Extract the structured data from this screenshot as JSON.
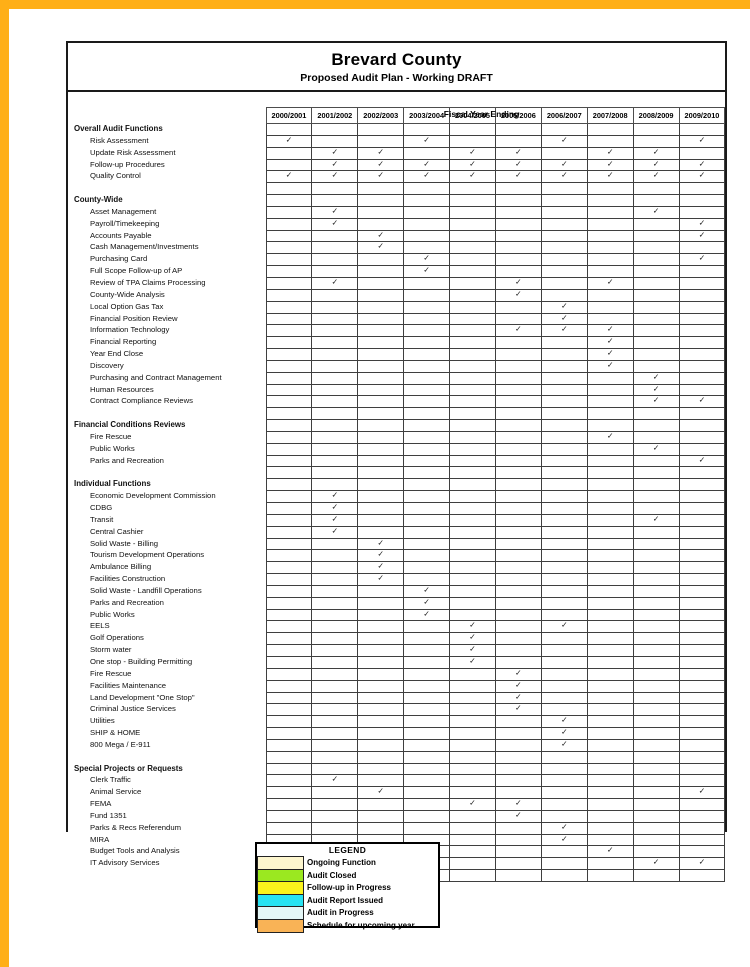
{
  "document": {
    "title_main": "Brevard County",
    "title_sub": "Proposed Audit Plan - Working DRAFT",
    "fiscal_year_header": "Fiscal Year Ending"
  },
  "columns": [
    "2000/2001",
    "2001/2002",
    "2002/2003",
    "2003/2004",
    "2004/2005",
    "2005/2006",
    "2006/2007",
    "2007/2008",
    "2008/2009",
    "2009/2010"
  ],
  "status_colors": {
    "ongoing": "#FDF6CE",
    "closed": "#9BE820",
    "followup": "#FAF31C",
    "issued": "#27E3F2",
    "inprogress": "#E4F7F7",
    "scheduled": "#F9B356"
  },
  "check_glyph": "✓",
  "legend": {
    "title": "LEGEND",
    "items": [
      {
        "label": "Ongoing Function",
        "key": "ongoing"
      },
      {
        "label": "Audit Closed",
        "key": "closed"
      },
      {
        "label": "Follow-up in Progress",
        "key": "followup"
      },
      {
        "label": "Audit Report Issued",
        "key": "issued"
      },
      {
        "label": "Audit in Progress",
        "key": "inprogress"
      },
      {
        "label": "Schedule for upcoming year",
        "key": "scheduled"
      }
    ]
  },
  "sections": [
    {
      "name": "Overall Audit Functions",
      "rows": [
        {
          "label": "Risk Assessment",
          "marks": {
            "0": "ongoing",
            "3": "ongoing",
            "6": "ongoing",
            "9": "ongoing"
          }
        },
        {
          "label": "Update Risk Assessment",
          "marks": {
            "1": "ongoing",
            "2": "ongoing",
            "4": "ongoing",
            "5": "ongoing",
            "7": "ongoing",
            "8": "ongoing"
          }
        },
        {
          "label": "Follow-up Procedures",
          "marks": {
            "1": "ongoing",
            "2": "ongoing",
            "3": "ongoing",
            "4": "ongoing",
            "5": "ongoing",
            "6": "ongoing",
            "7": "ongoing",
            "8": "ongoing",
            "9": "ongoing"
          }
        },
        {
          "label": "Quality Control",
          "marks": {
            "0": "ongoing",
            "1": "ongoing",
            "2": "ongoing",
            "3": "ongoing",
            "4": "ongoing",
            "5": "ongoing",
            "6": "ongoing",
            "7": "ongoing",
            "8": "ongoing",
            "9": "ongoing"
          }
        }
      ]
    },
    {
      "name": "County-Wide",
      "rows": [
        {
          "label": "Asset Management",
          "marks": {
            "1": "closed",
            "8": "issued"
          }
        },
        {
          "label": "Payroll/Timekeeping",
          "marks": {
            "1": "closed",
            "9": "scheduled"
          }
        },
        {
          "label": "Accounts Payable",
          "marks": {
            "2": "closed",
            "9": "scheduled"
          }
        },
        {
          "label": "Cash Management/Investments",
          "marks": {
            "2": "closed"
          }
        },
        {
          "label": "Purchasing Card",
          "marks": {
            "3": "closed",
            "9": "scheduled"
          }
        },
        {
          "label": "Full Scope Follow-up of AP",
          "marks": {
            "3": "closed"
          }
        },
        {
          "label": "Review of TPA Claims Processing",
          "marks": {
            "1": "closed",
            "5": "closed",
            "7": "closed"
          }
        },
        {
          "label": "County-Wide Analysis",
          "marks": {
            "5": "closed"
          }
        },
        {
          "label": "Local Option Gas Tax",
          "marks": {
            "6": "closed"
          }
        },
        {
          "label": "Financial Position Review",
          "marks": {
            "6": "closed"
          }
        },
        {
          "label": "Information Technology",
          "marks": {
            "5": "followup",
            "6": "followup",
            "7": "followup"
          }
        },
        {
          "label": "Financial Reporting",
          "marks": {
            "7": "issued"
          }
        },
        {
          "label": "Year End Close",
          "marks": {
            "7": "followup"
          }
        },
        {
          "label": "Discovery",
          "marks": {
            "7": "closed"
          }
        },
        {
          "label": "Purchasing and Contract Management",
          "marks": {
            "8": "issued"
          }
        },
        {
          "label": "Human Resources",
          "marks": {
            "8": "issued"
          }
        },
        {
          "label": "Contract Compliance Reviews",
          "marks": {
            "8": "issued",
            "9": "scheduled"
          }
        }
      ]
    },
    {
      "name": "Financial Conditions Reviews",
      "rows": [
        {
          "label": "Fire Rescue",
          "marks": {
            "7": "followup"
          }
        },
        {
          "label": "Public Works",
          "marks": {
            "8": "inprogress"
          }
        },
        {
          "label": "Parks and Recreation",
          "marks": {
            "9": "scheduled"
          }
        }
      ]
    },
    {
      "name": "Individual Functions",
      "rows": [
        {
          "label": "Economic Development Commission",
          "marks": {
            "1": "closed"
          }
        },
        {
          "label": "CDBG",
          "marks": {
            "1": "closed"
          }
        },
        {
          "label": "Transit",
          "marks": {
            "1": "closed",
            "8": "followup"
          }
        },
        {
          "label": "Central Cashier",
          "marks": {
            "1": "closed"
          }
        },
        {
          "label": "Solid Waste - Billing",
          "marks": {
            "2": "closed"
          }
        },
        {
          "label": "Tourism Development Operations",
          "marks": {
            "2": "closed"
          }
        },
        {
          "label": "Ambulance Billing",
          "marks": {
            "2": "closed"
          }
        },
        {
          "label": "Facilities Construction",
          "marks": {
            "2": "closed"
          }
        },
        {
          "label": "Solid Waste - Landfill Operations",
          "marks": {
            "3": "closed"
          }
        },
        {
          "label": "Parks and Recreation",
          "marks": {
            "3": "closed"
          }
        },
        {
          "label": "Public Works",
          "marks": {
            "3": "closed"
          }
        },
        {
          "label": "EELS",
          "marks": {
            "4": "closed",
            "6": "closed"
          }
        },
        {
          "label": "Golf Operations",
          "marks": {
            "4": "closed"
          }
        },
        {
          "label": "Storm water",
          "marks": {
            "4": "closed"
          }
        },
        {
          "label": "One stop - Building Permitting",
          "marks": {
            "4": "closed"
          }
        },
        {
          "label": "Fire Rescue",
          "marks": {
            "5": "closed"
          }
        },
        {
          "label": "Facilities Maintenance",
          "marks": {
            "5": "closed"
          }
        },
        {
          "label": "Land Development  \"One Stop\"",
          "marks": {
            "5": "closed"
          }
        },
        {
          "label": "Criminal Justice Services",
          "marks": {
            "5": "closed"
          }
        },
        {
          "label": "Utilities",
          "marks": {
            "6": "closed"
          }
        },
        {
          "label": "SHIP & HOME",
          "marks": {
            "6": "followup"
          }
        },
        {
          "label": "800 Mega / E-911",
          "marks": {
            "6": "followup"
          }
        }
      ]
    },
    {
      "name": "Special Projects or Requests",
      "rows": [
        {
          "label": "Clerk Traffic",
          "marks": {
            "1": "closed"
          }
        },
        {
          "label": "Animal Service",
          "marks": {
            "2": "closed",
            "9": "scheduled"
          }
        },
        {
          "label": "FEMA",
          "marks": {
            "4": "closed",
            "5": "closed"
          }
        },
        {
          "label": "Fund 1351",
          "marks": {
            "5": "closed"
          }
        },
        {
          "label": "Parks & Recs Referendum",
          "marks": {
            "6": "closed"
          }
        },
        {
          "label": "MIRA",
          "marks": {
            "6": "followup"
          }
        },
        {
          "label": "Budget Tools and Analysis",
          "marks": {
            "7": "closed"
          }
        },
        {
          "label": "IT Advisory Services",
          "marks": {
            "8": "issued",
            "9": "scheduled"
          }
        }
      ]
    }
  ]
}
